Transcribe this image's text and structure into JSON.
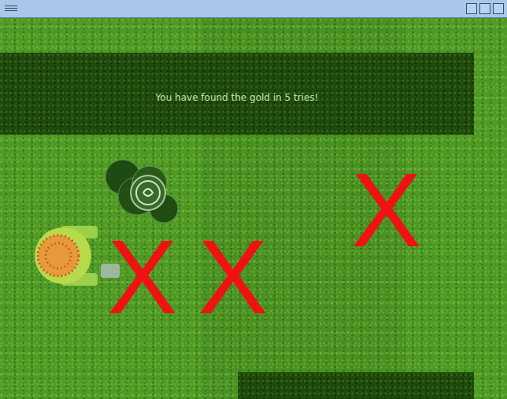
{
  "message": "You have found the gold in 5 tries!",
  "marks": [
    {
      "label": "X"
    },
    {
      "label": "X"
    },
    {
      "label": "X"
    }
  ]
}
